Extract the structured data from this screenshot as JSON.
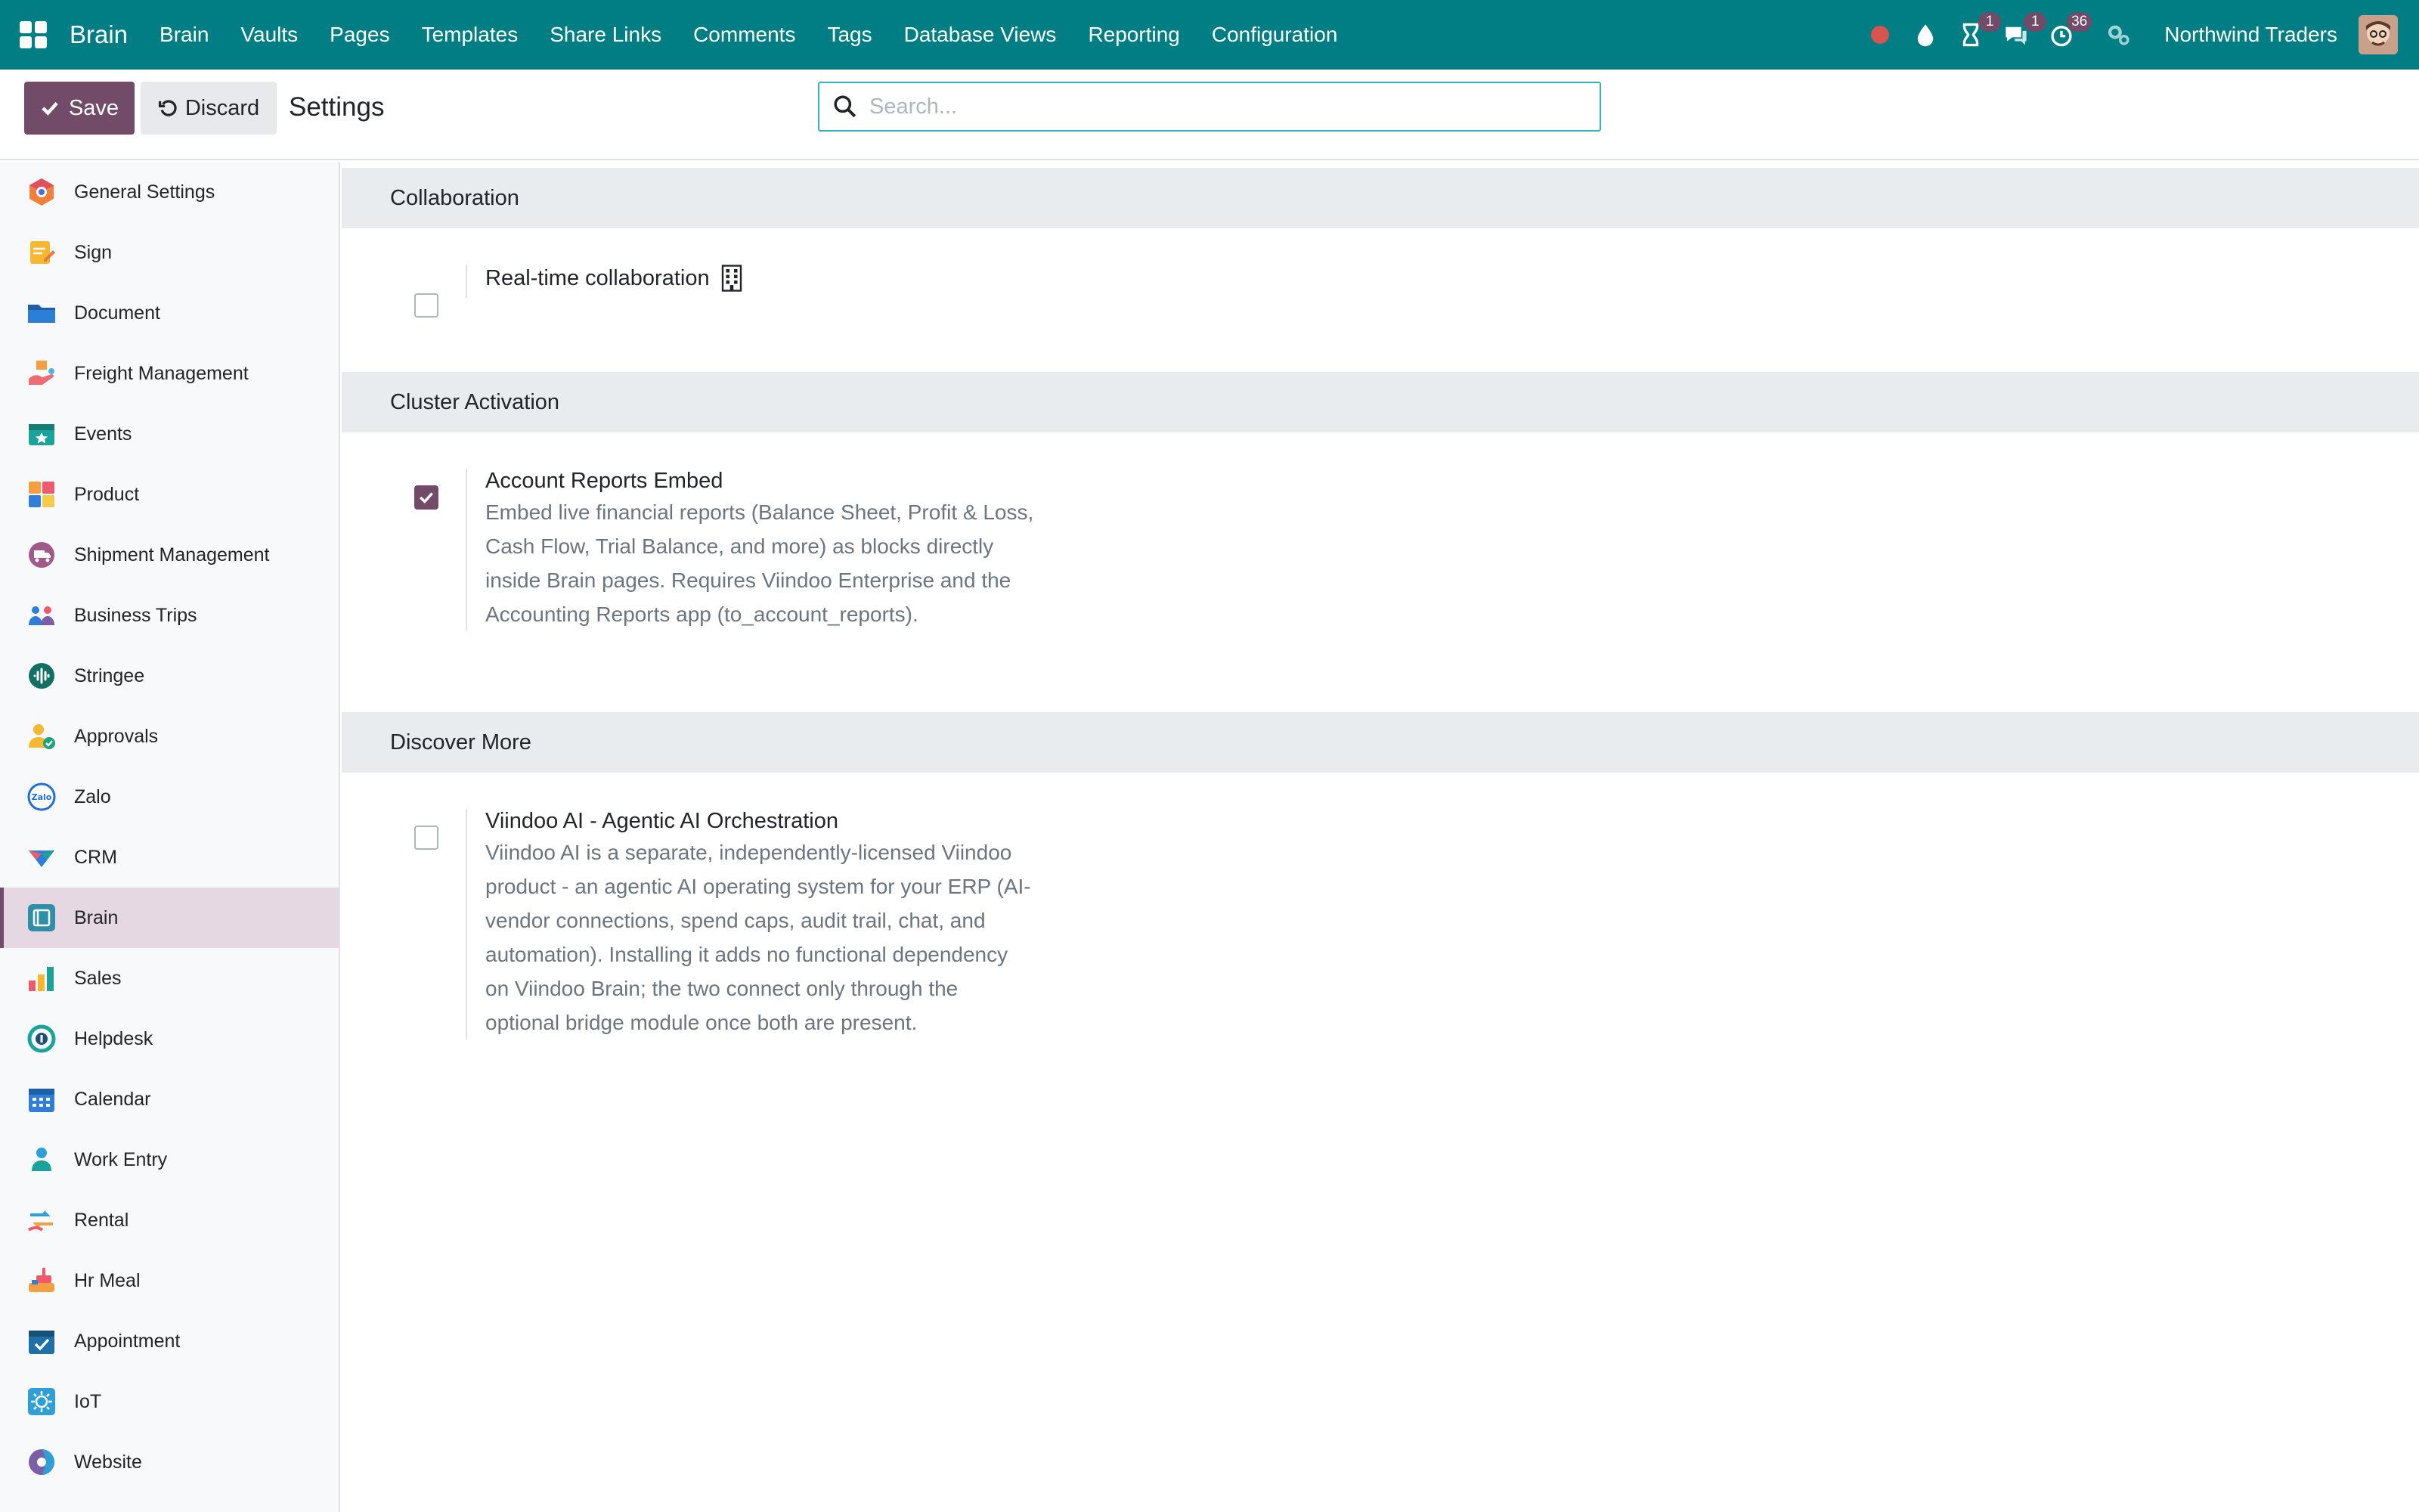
{
  "navbar": {
    "brand": "Brain",
    "menu": [
      "Brain",
      "Vaults",
      "Pages",
      "Templates",
      "Share Links",
      "Comments",
      "Tags",
      "Database Views",
      "Reporting",
      "Configuration"
    ],
    "badges": {
      "activities": "1",
      "messages": "1",
      "timer": "36"
    },
    "company": "Northwind Traders"
  },
  "control": {
    "save_label": "Save",
    "discard_label": "Discard",
    "title": "Settings",
    "search_placeholder": "Search..."
  },
  "sidebar": {
    "items": [
      {
        "label": "General Settings",
        "icon": "general-settings-icon"
      },
      {
        "label": "Sign",
        "icon": "sign-icon"
      },
      {
        "label": "Document",
        "icon": "document-icon"
      },
      {
        "label": "Freight Management",
        "icon": "freight-icon"
      },
      {
        "label": "Events",
        "icon": "events-icon"
      },
      {
        "label": "Product",
        "icon": "product-icon"
      },
      {
        "label": "Shipment Management",
        "icon": "shipment-icon"
      },
      {
        "label": "Business Trips",
        "icon": "business-trips-icon"
      },
      {
        "label": "Stringee",
        "icon": "stringee-icon"
      },
      {
        "label": "Approvals",
        "icon": "approvals-icon"
      },
      {
        "label": "Zalo",
        "icon": "zalo-icon"
      },
      {
        "label": "CRM",
        "icon": "crm-icon"
      },
      {
        "label": "Brain",
        "icon": "brain-icon"
      },
      {
        "label": "Sales",
        "icon": "sales-icon"
      },
      {
        "label": "Helpdesk",
        "icon": "helpdesk-icon"
      },
      {
        "label": "Calendar",
        "icon": "calendar-icon"
      },
      {
        "label": "Work Entry",
        "icon": "work-entry-icon"
      },
      {
        "label": "Rental",
        "icon": "rental-icon"
      },
      {
        "label": "Hr Meal",
        "icon": "hr-meal-icon"
      },
      {
        "label": "Appointment",
        "icon": "appointment-icon"
      },
      {
        "label": "IoT",
        "icon": "iot-icon"
      },
      {
        "label": "Website",
        "icon": "website-icon"
      }
    ],
    "active": "Brain"
  },
  "sections": {
    "collaboration": {
      "title": "Collaboration",
      "settings": [
        {
          "label": "Real-time collaboration",
          "checked": false,
          "icon": "building-icon"
        }
      ]
    },
    "cluster": {
      "title": "Cluster Activation",
      "settings": [
        {
          "label": "Account Reports Embed",
          "checked": true,
          "description_lines": [
            "Embed live financial reports (Balance Sheet, Profit & Loss,",
            "Cash Flow, Trial Balance, and more) as blocks directly",
            "inside Brain pages. Requires Viindoo Enterprise and the",
            "Accounting Reports app (to_account_reports)."
          ]
        }
      ]
    },
    "discover": {
      "title": "Discover More",
      "settings": [
        {
          "label": "Viindoo AI - Agentic AI Orchestration",
          "checked": false,
          "description_lines": [
            "Viindoo AI is a separate, independently-licensed Viindoo",
            "product - an agentic AI operating system for your ERP (AI-",
            "vendor connections, spend caps, audit trail, chat, and",
            "automation). Installing it adds no functional dependency",
            "on Viindoo Brain; the two connect only through the",
            "optional bridge module once both are present."
          ]
        }
      ]
    }
  },
  "colors": {
    "navbar": "#017e84",
    "primary": "#714b67",
    "active_sidebar": "#e6d8e3",
    "section_header": "#e9ecef"
  }
}
